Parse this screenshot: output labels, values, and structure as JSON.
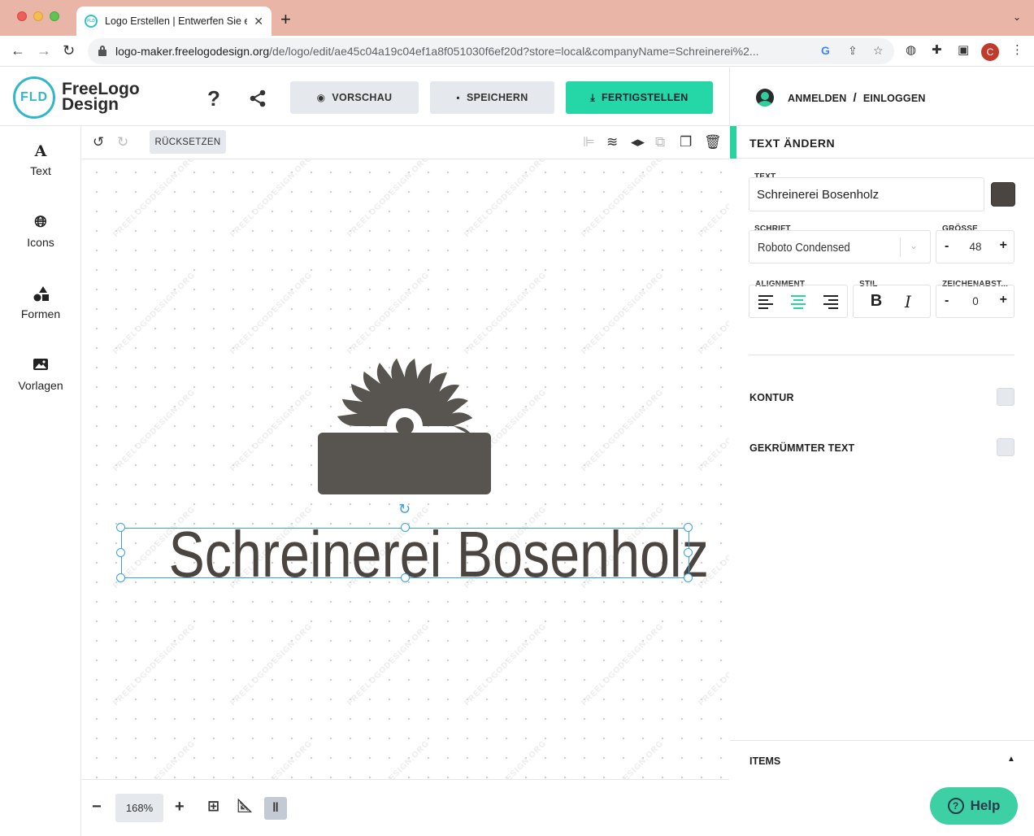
{
  "browser": {
    "tab_title": "Logo Erstellen | Entwerfen Sie e",
    "tab_favicon_text": "FLD",
    "url_host": "logo-maker.freelogodesign.org",
    "url_path": "/de/logo/edit/ae45c04a19c04ef1a8f051030f6ef20d?store=local&companyName=Schreinerei%2...",
    "profile_initial": "C"
  },
  "header": {
    "logo_mark": "FLD",
    "logo_line1": "FreeLogo",
    "logo_line2": "Design",
    "help_glyph": "?",
    "preview_label": "VORSCHAU",
    "save_label": "SPEICHERN",
    "finish_label": "FERTIGSTELLEN",
    "register_label": "ANMELDEN",
    "separator": "/",
    "login_label": "EINLOGGEN",
    "finish_color": "#25d7a6"
  },
  "sidebar": {
    "items": [
      {
        "label": "Text",
        "icon": "text-icon"
      },
      {
        "label": "Icons",
        "icon": "globe-icon"
      },
      {
        "label": "Formen",
        "icon": "shapes-icon"
      },
      {
        "label": "Vorlagen",
        "icon": "image-icon"
      }
    ]
  },
  "canvas": {
    "reset_label": "RÜCKSETZEN",
    "company_text": "Schreinerei Bosenholz",
    "watermark": "FREELOGODESIGN.ORG",
    "logo_icon": "saw-blade-icon",
    "logo_color": "#58544f",
    "zoom": "168%"
  },
  "panel": {
    "title": "TEXT ÄNDERN",
    "text_label": "TEXT",
    "text_value": "Schreinerei Bosenholz",
    "text_color": "#4a4541",
    "font_label": "SCHRIFT",
    "font_value": "Roboto Condensed",
    "size_label": "GRÖSSE",
    "size_value": "48",
    "alignment_label": "ALIGNMENT",
    "style_label": "STIL",
    "spacing_label": "ZEICHENABST...",
    "spacing_value": "0",
    "bold_glyph": "B",
    "italic_glyph": "I",
    "minus": "-",
    "plus": "+",
    "outline_label": "KONTUR",
    "curved_label": "GEKRÜMMTER TEXT",
    "items_label": "ITEMS",
    "accent_color": "#28d3a0"
  },
  "help": {
    "label": "Help"
  }
}
